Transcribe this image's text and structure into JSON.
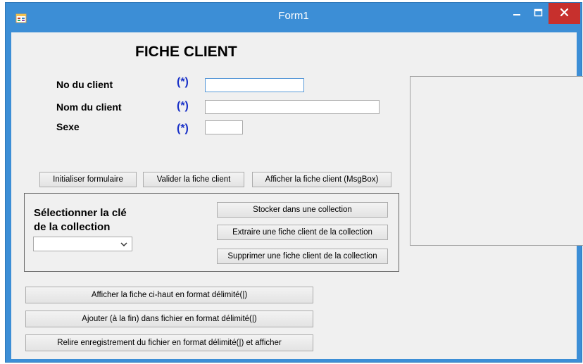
{
  "window": {
    "title": "Form1"
  },
  "form": {
    "heading": "FICHE CLIENT",
    "fields": [
      {
        "label": "No du client",
        "required": "(*)"
      },
      {
        "label": "Nom du client",
        "required": "(*)"
      },
      {
        "label": "Sexe",
        "required": "(*)"
      }
    ],
    "buttons_row": [
      "Initialiser formulaire",
      "Valider la fiche client",
      "Afficher la fiche client (MsgBox)"
    ],
    "collection": {
      "label_line1": "Sélectionner la clé",
      "label_line2": "de la collection",
      "selected_value": "",
      "buttons": [
        "Stocker dans une collection",
        "Extraire une fiche client de la collection",
        "Supprimer une fiche client de la collection"
      ]
    },
    "bottom_buttons": [
      "Afficher la fiche ci-haut en format délimité(|)",
      "Ajouter (à la fin) dans fichier en format délimité(|)",
      "Relire enregistrement du fichier en format délimité(|) et afficher"
    ]
  },
  "colors": {
    "titlebar": "#3c8ed6",
    "close": "#c7302d",
    "required": "#1a32c8"
  }
}
